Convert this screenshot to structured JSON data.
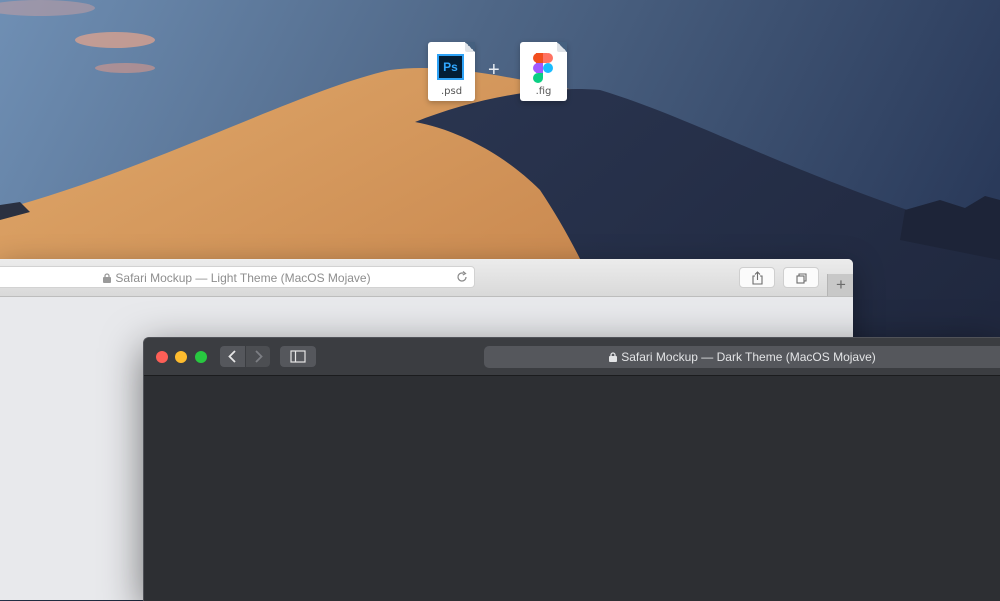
{
  "desktop": {
    "files": [
      {
        "extension": ".psd",
        "logo_text": "Ps",
        "icon": "photoshop-file-icon"
      },
      {
        "extension": ".fig",
        "icon": "figma-file-icon"
      }
    ],
    "separator": "+"
  },
  "light_window": {
    "address_text": "Safari Mockup — Light Theme (MacOS Mojave)",
    "icons": [
      "lock-icon",
      "reload-icon",
      "share-icon",
      "tabs-icon"
    ],
    "new_tab_symbol": "+"
  },
  "dark_window": {
    "address_text": "Safari Mockup — Dark Theme (MacOS Mojave)",
    "icons": [
      "lock-icon",
      "chevron-left-icon",
      "chevron-right-icon",
      "sidebar-icon"
    ],
    "traffic_light_colors": {
      "close": "#fd5f57",
      "minimize": "#febc2e",
      "zoom": "#28c840"
    }
  },
  "colors": {
    "light_toolbar": "#dedede",
    "dark_toolbar": "#3b3d41",
    "dark_content": "#2d2f33",
    "light_content": "#e8e9ec"
  }
}
